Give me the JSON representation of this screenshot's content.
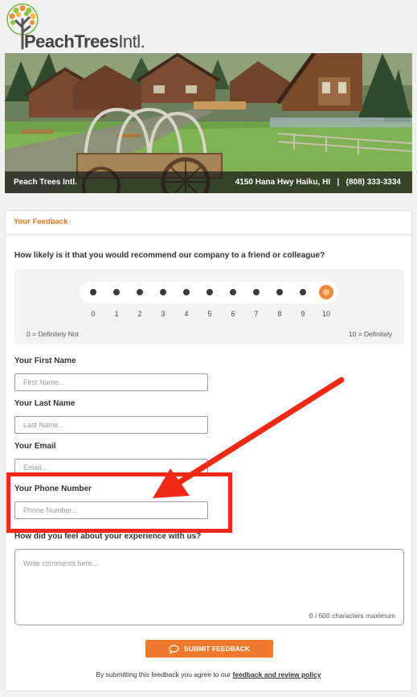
{
  "header": {
    "logo_prefix": "PeachTrees",
    "logo_suffix": "Intl."
  },
  "hero": {
    "company": "Peach Trees Intl.",
    "address": "4150 Hana Hwy Haiku, HI",
    "separator": "|",
    "phone": "(808) 333-3334"
  },
  "panel": {
    "title": "Your Feedback",
    "question": "How likely is it that you would recommend our company to a friend or colleague?",
    "scale": [
      "0",
      "1",
      "2",
      "3",
      "4",
      "5",
      "6",
      "7",
      "8",
      "9",
      "10"
    ],
    "selected_score": 10,
    "low_label": "0 = Definitely Not",
    "high_label": "10 = Definitely",
    "first_name_label": "Your First Name",
    "first_name_placeholder": "First Name...",
    "last_name_label": "Your Last Name",
    "last_name_placeholder": "Last Name...",
    "email_label": "Your Email",
    "email_placeholder": "Email...",
    "phone_label": "Your Phone Number",
    "phone_placeholder": "Phone Number...",
    "experience_label": "How did you feel about your experience with us?",
    "comments_placeholder": "Write comments here...",
    "char_count": "0 / 500 characters maximum",
    "submit_label": "SUBMIT FEEDBACK",
    "policy_prefix": "By submitting this feedback you agree to our",
    "policy_link": "feedback and review policy"
  },
  "colors": {
    "accent": "#ee7a2e",
    "annotation": "#ee2a17"
  },
  "icons": {
    "submit": "speech-bubble-icon"
  }
}
